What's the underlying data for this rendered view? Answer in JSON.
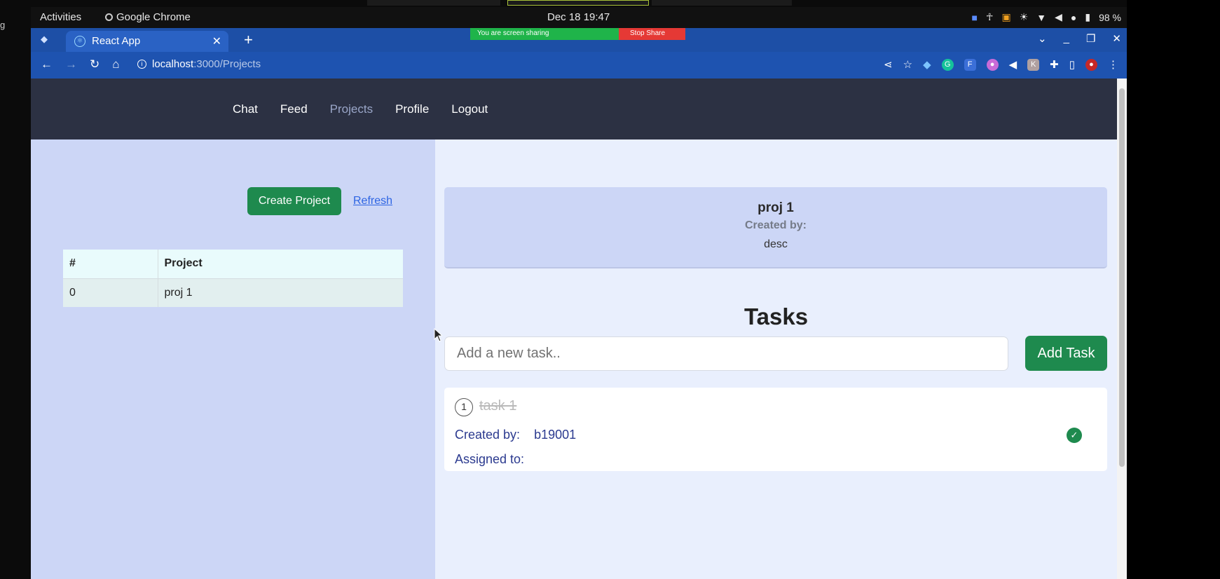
{
  "desktop": {
    "activities": "Activities",
    "app_name": "Google Chrome",
    "clock": "Dec 18  19:47",
    "battery": "98 %",
    "edge_text": "g"
  },
  "browser": {
    "tab_title": "React App",
    "url_host": "localhost",
    "url_path": ":3000/Projects",
    "share_text": "You are screen sharing",
    "stop_share": "Stop Share"
  },
  "nav": {
    "links": [
      "Chat",
      "Feed",
      "Projects",
      "Profile",
      "Logout"
    ],
    "active": "Projects"
  },
  "projects": {
    "create_button": "Create Project",
    "refresh_link": "Refresh",
    "table": {
      "headers": [
        "#",
        "Project"
      ],
      "rows": [
        [
          "0",
          "proj 1"
        ]
      ]
    }
  },
  "project_detail": {
    "name": "proj 1",
    "created_by_label": "Created by:",
    "description": "desc"
  },
  "tasks": {
    "title": "Tasks",
    "input_placeholder": "Add a new task..",
    "add_button": "Add Task",
    "items": [
      {
        "number": "1",
        "name": "task 1",
        "created_by_label": "Created by:",
        "created_by": "b19001",
        "assigned_to_label": "Assigned to:",
        "assigned_to": "",
        "completed": true
      }
    ]
  },
  "colors": {
    "accent_green": "#1e8a4e",
    "navbar": "#2c3143",
    "chrome_blue": "#1d4fa6",
    "left_pane": "#ccd6f6"
  }
}
